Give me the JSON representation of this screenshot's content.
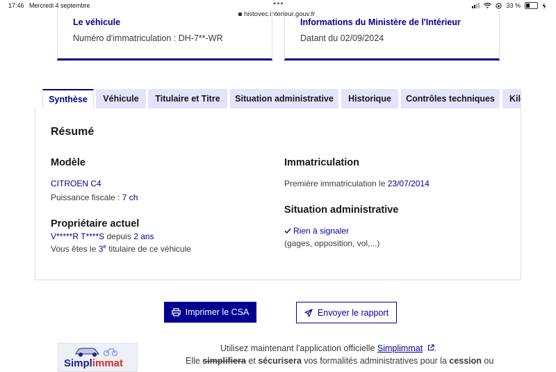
{
  "status_bar": {
    "time": "17:46",
    "date": "Mercredi 4 septembre",
    "url": "histovec.interieur.gouv.fr",
    "battery": "33 %"
  },
  "cards": {
    "vehicle": {
      "title": "Le véhicule",
      "text": "Numéro d'immatriculation : DH-7**-WR"
    },
    "ministry": {
      "title": "Informations du Ministère de l'Intérieur",
      "text": "Datant du 02/09/2024"
    }
  },
  "tabs": [
    {
      "label": "Synthèse",
      "active": true
    },
    {
      "label": "Véhicule"
    },
    {
      "label": "Titulaire et Titre"
    },
    {
      "label": "Situation administrative"
    },
    {
      "label": "Historique"
    },
    {
      "label": "Contrôles techniques"
    },
    {
      "label": "Kilo"
    }
  ],
  "summary": {
    "title": "Résumé",
    "model": {
      "heading": "Modèle",
      "name": "CITROEN C4",
      "fiscal_label": "Puissance fiscale : ",
      "fiscal_value": "7 ch"
    },
    "owner": {
      "heading": "Propriétaire actuel",
      "name": "V*****R T****S",
      "since_label": " depuis ",
      "since_value": "2 ans",
      "rank_prefix": "Vous êtes le ",
      "rank_num": "3",
      "rank_sup": "e",
      "rank_suffix": " titulaire de ce véhicule"
    },
    "registration": {
      "heading": "Immatriculation",
      "first_label": "Première immatriculation le ",
      "first_date": "23/07/2014"
    },
    "admin": {
      "heading": "Situation administrative",
      "status": "Rien à signaler",
      "detail": "(gages, opposition, vol,...)"
    }
  },
  "actions": {
    "print": "Imprimer le CSA",
    "send": "Envoyer le rapport"
  },
  "footer": {
    "logo_a": "Simpl",
    "logo_b": "immat",
    "line1_prefix": "Utilisez maintenant l'application officielle ",
    "line1_link": "Simplimmat",
    "line1_suffix": ".",
    "line2_a": "Elle ",
    "line2_b": "simplifiera",
    "line2_c": " et ",
    "line2_d": "sécurisera",
    "line2_e": " vos formalités administratives pour la ",
    "line2_f": "cession",
    "line2_g": " ou"
  },
  "colors": {
    "accent": "#000091",
    "tab_bg": "#e3e3fd"
  }
}
